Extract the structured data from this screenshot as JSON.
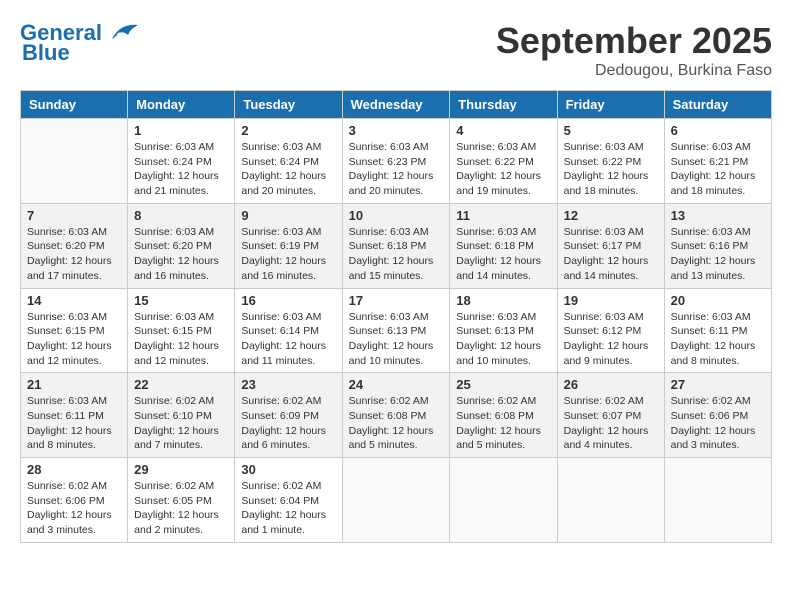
{
  "logo": {
    "line1": "General",
    "line2": "Blue"
  },
  "header": {
    "month": "September 2025",
    "location": "Dedougou, Burkina Faso"
  },
  "days_of_week": [
    "Sunday",
    "Monday",
    "Tuesday",
    "Wednesday",
    "Thursday",
    "Friday",
    "Saturday"
  ],
  "weeks": [
    [
      {
        "day": "",
        "info": ""
      },
      {
        "day": "1",
        "info": "Sunrise: 6:03 AM\nSunset: 6:24 PM\nDaylight: 12 hours\nand 21 minutes."
      },
      {
        "day": "2",
        "info": "Sunrise: 6:03 AM\nSunset: 6:24 PM\nDaylight: 12 hours\nand 20 minutes."
      },
      {
        "day": "3",
        "info": "Sunrise: 6:03 AM\nSunset: 6:23 PM\nDaylight: 12 hours\nand 20 minutes."
      },
      {
        "day": "4",
        "info": "Sunrise: 6:03 AM\nSunset: 6:22 PM\nDaylight: 12 hours\nand 19 minutes."
      },
      {
        "day": "5",
        "info": "Sunrise: 6:03 AM\nSunset: 6:22 PM\nDaylight: 12 hours\nand 18 minutes."
      },
      {
        "day": "6",
        "info": "Sunrise: 6:03 AM\nSunset: 6:21 PM\nDaylight: 12 hours\nand 18 minutes."
      }
    ],
    [
      {
        "day": "7",
        "info": "Sunrise: 6:03 AM\nSunset: 6:20 PM\nDaylight: 12 hours\nand 17 minutes."
      },
      {
        "day": "8",
        "info": "Sunrise: 6:03 AM\nSunset: 6:20 PM\nDaylight: 12 hours\nand 16 minutes."
      },
      {
        "day": "9",
        "info": "Sunrise: 6:03 AM\nSunset: 6:19 PM\nDaylight: 12 hours\nand 16 minutes."
      },
      {
        "day": "10",
        "info": "Sunrise: 6:03 AM\nSunset: 6:18 PM\nDaylight: 12 hours\nand 15 minutes."
      },
      {
        "day": "11",
        "info": "Sunrise: 6:03 AM\nSunset: 6:18 PM\nDaylight: 12 hours\nand 14 minutes."
      },
      {
        "day": "12",
        "info": "Sunrise: 6:03 AM\nSunset: 6:17 PM\nDaylight: 12 hours\nand 14 minutes."
      },
      {
        "day": "13",
        "info": "Sunrise: 6:03 AM\nSunset: 6:16 PM\nDaylight: 12 hours\nand 13 minutes."
      }
    ],
    [
      {
        "day": "14",
        "info": "Sunrise: 6:03 AM\nSunset: 6:15 PM\nDaylight: 12 hours\nand 12 minutes."
      },
      {
        "day": "15",
        "info": "Sunrise: 6:03 AM\nSunset: 6:15 PM\nDaylight: 12 hours\nand 12 minutes."
      },
      {
        "day": "16",
        "info": "Sunrise: 6:03 AM\nSunset: 6:14 PM\nDaylight: 12 hours\nand 11 minutes."
      },
      {
        "day": "17",
        "info": "Sunrise: 6:03 AM\nSunset: 6:13 PM\nDaylight: 12 hours\nand 10 minutes."
      },
      {
        "day": "18",
        "info": "Sunrise: 6:03 AM\nSunset: 6:13 PM\nDaylight: 12 hours\nand 10 minutes."
      },
      {
        "day": "19",
        "info": "Sunrise: 6:03 AM\nSunset: 6:12 PM\nDaylight: 12 hours\nand 9 minutes."
      },
      {
        "day": "20",
        "info": "Sunrise: 6:03 AM\nSunset: 6:11 PM\nDaylight: 12 hours\nand 8 minutes."
      }
    ],
    [
      {
        "day": "21",
        "info": "Sunrise: 6:03 AM\nSunset: 6:11 PM\nDaylight: 12 hours\nand 8 minutes."
      },
      {
        "day": "22",
        "info": "Sunrise: 6:02 AM\nSunset: 6:10 PM\nDaylight: 12 hours\nand 7 minutes."
      },
      {
        "day": "23",
        "info": "Sunrise: 6:02 AM\nSunset: 6:09 PM\nDaylight: 12 hours\nand 6 minutes."
      },
      {
        "day": "24",
        "info": "Sunrise: 6:02 AM\nSunset: 6:08 PM\nDaylight: 12 hours\nand 5 minutes."
      },
      {
        "day": "25",
        "info": "Sunrise: 6:02 AM\nSunset: 6:08 PM\nDaylight: 12 hours\nand 5 minutes."
      },
      {
        "day": "26",
        "info": "Sunrise: 6:02 AM\nSunset: 6:07 PM\nDaylight: 12 hours\nand 4 minutes."
      },
      {
        "day": "27",
        "info": "Sunrise: 6:02 AM\nSunset: 6:06 PM\nDaylight: 12 hours\nand 3 minutes."
      }
    ],
    [
      {
        "day": "28",
        "info": "Sunrise: 6:02 AM\nSunset: 6:06 PM\nDaylight: 12 hours\nand 3 minutes."
      },
      {
        "day": "29",
        "info": "Sunrise: 6:02 AM\nSunset: 6:05 PM\nDaylight: 12 hours\nand 2 minutes."
      },
      {
        "day": "30",
        "info": "Sunrise: 6:02 AM\nSunset: 6:04 PM\nDaylight: 12 hours\nand 1 minute."
      },
      {
        "day": "",
        "info": ""
      },
      {
        "day": "",
        "info": ""
      },
      {
        "day": "",
        "info": ""
      },
      {
        "day": "",
        "info": ""
      }
    ]
  ]
}
